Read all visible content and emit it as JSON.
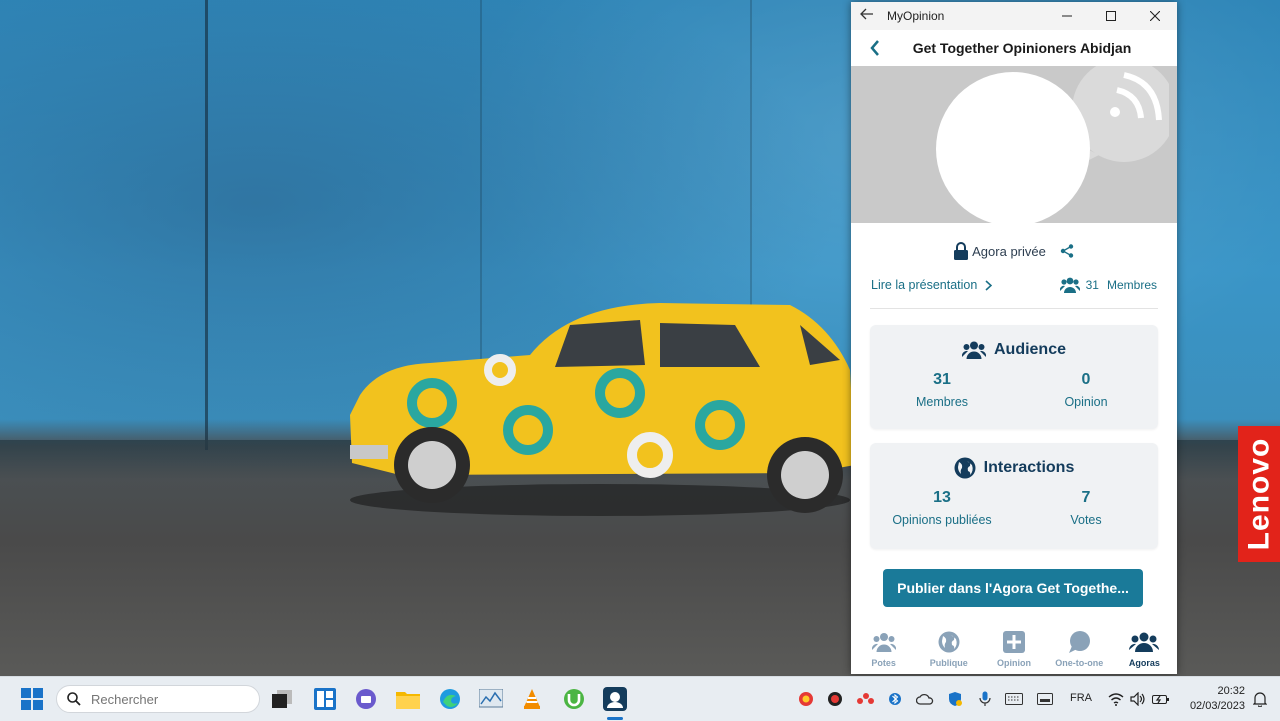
{
  "window": {
    "app_title": "MyOpinion",
    "header_title": "Get Together Opinioners Abidjan"
  },
  "agora": {
    "privacy_label": "Agora privée",
    "read_link": "Lire la présentation",
    "members_count": "31",
    "members_label": "Membres"
  },
  "audience": {
    "title": "Audience",
    "members_value": "31",
    "members_label": "Membres",
    "opinion_value": "0",
    "opinion_label": "Opinion"
  },
  "interactions": {
    "title": "Interactions",
    "published_value": "13",
    "published_label": "Opinions publiées",
    "votes_value": "7",
    "votes_label": "Votes"
  },
  "publish_button": "Publier dans l'Agora Get Togethe...",
  "bottom_nav": {
    "items": [
      {
        "label": "Potes",
        "icon": "friends-icon"
      },
      {
        "label": "Publique",
        "icon": "globe-icon"
      },
      {
        "label": "Opinion",
        "icon": "plus-square-icon"
      },
      {
        "label": "One-to-one",
        "icon": "chat-icon"
      },
      {
        "label": "Agoras",
        "icon": "group-icon"
      }
    ],
    "active": "Agoras"
  },
  "taskbar": {
    "search_placeholder": "Rechercher",
    "language": "FRA",
    "time": "20:32",
    "date": "02/03/2023"
  },
  "desktop": {
    "brand_badge": "Lenovo"
  },
  "colors": {
    "accent": "#1a7a99",
    "heading": "#143c5c",
    "link": "#1a6f86",
    "card_bg": "#f0f2f4",
    "brand_badge": "#e2231a"
  }
}
